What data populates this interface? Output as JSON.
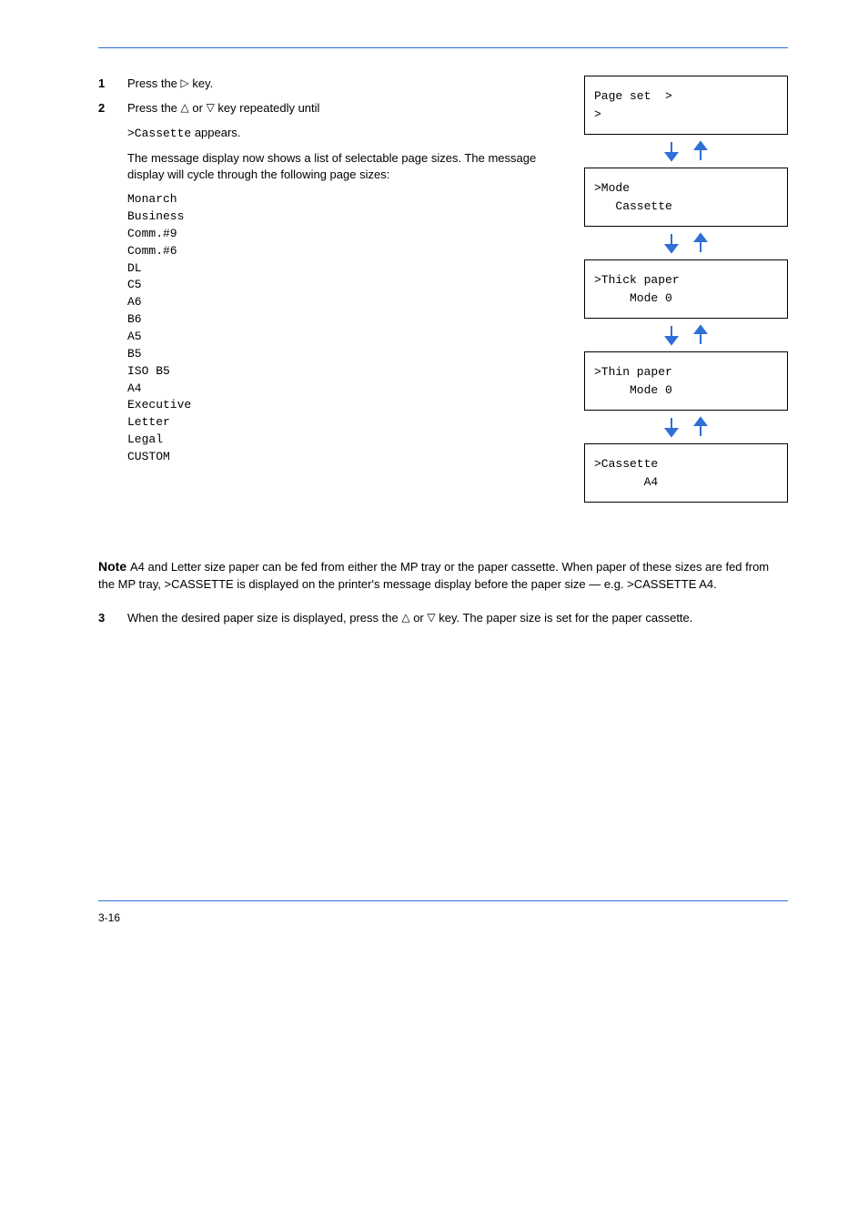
{
  "steps": [
    {
      "num": "1",
      "text_before": "Press the ",
      "key": "▷",
      "text_after": " key."
    },
    {
      "num": "2",
      "text_before": "Press the ",
      "key1": "△",
      "text_mid": " or ",
      "key2": "▽",
      "text_after": " key repeatedly until "
    },
    {
      "num2_after": "   appears."
    }
  ],
  "cont1": "The message display now shows a list of selectable page sizes. The message display will cycle through the following page sizes:",
  "sizes": "Monarch\nBusiness\nComm.#9\nComm.#6\nDL\nC5\nA6\nB6\nA5\nB5\nISO B5\nA4\nExecutive\nLetter\nLegal\nCUSTOM",
  "note_bold": "Note ",
  "note_text": "A4 and Letter size paper can be fed from either the MP tray or the paper cassette. When paper of these sizes are fed from the MP tray, >CASSETTE is displayed on the printer's message display before the paper size — e.g. >CASSETTE A4.",
  "step3": {
    "num": "3",
    "text_before": "When the desired paper size is displayed, press the ",
    "key1": "△",
    "text_mid": " or ",
    "key2": "▽",
    "text_after": " key. The paper size is set for the paper cassette."
  },
  "flow": {
    "box1": {
      "l1": "Page set  >",
      "l2": ">"
    },
    "box2": {
      "l1": ">Mode",
      "l2": "   Cassette"
    },
    "box3": {
      "l1": ">Thick paper",
      "l2": "     Mode 0"
    },
    "box4": {
      "l1": ">Thin paper",
      "l2": "     Mode 0"
    },
    "box5": {
      "l1": ">Cassette",
      "l2": "       A4"
    }
  },
  "footer": "3-16"
}
